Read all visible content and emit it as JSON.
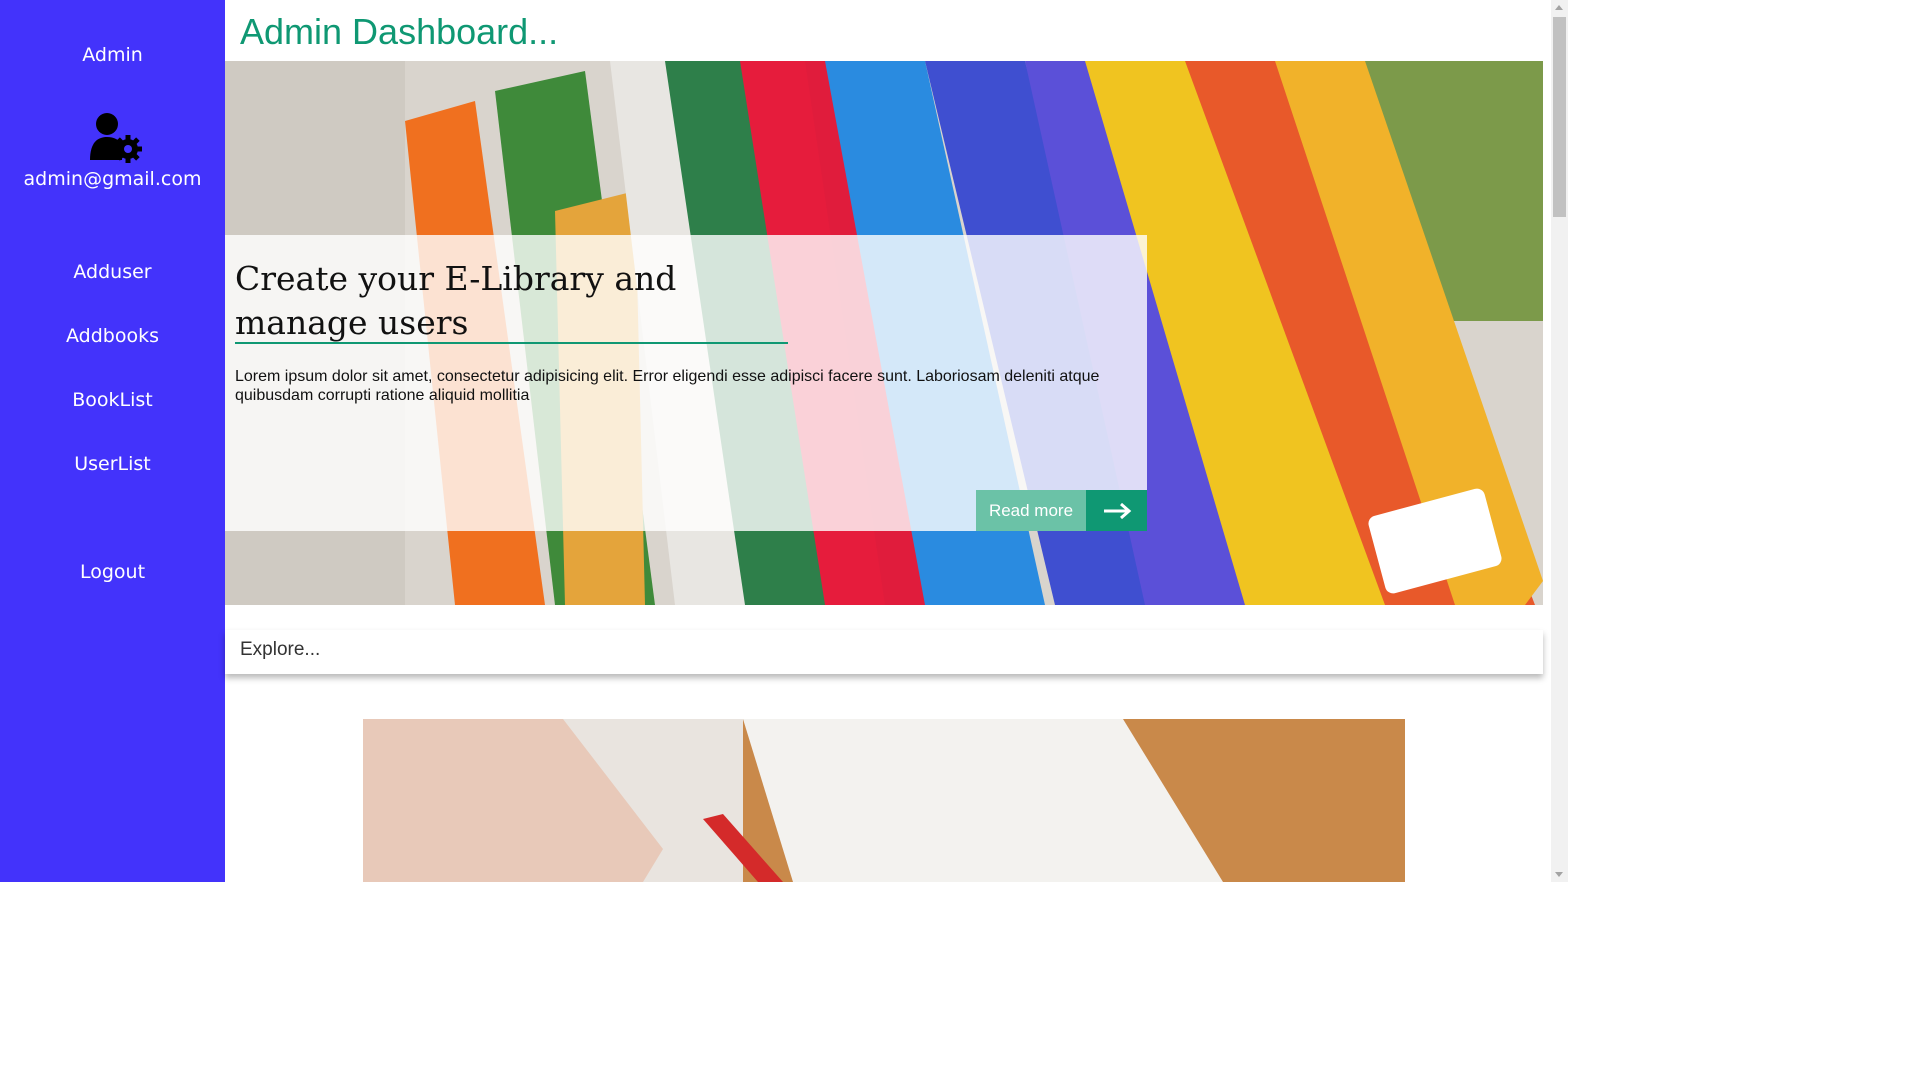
{
  "sidebar": {
    "title": "Admin",
    "avatar_icon": "user-gear-icon",
    "email": "admin@gmail.com",
    "items": [
      {
        "label": "Adduser"
      },
      {
        "label": "Addbooks"
      },
      {
        "label": "BookList"
      },
      {
        "label": "UserList"
      }
    ],
    "logout_label": "Logout",
    "background": "#4333fb"
  },
  "header": {
    "title": "Admin Dashboard...",
    "title_color": "#0f9873"
  },
  "hero": {
    "heading": "Create your E-Library and manage users",
    "text": "Lorem ipsum dolor sit amet, consectetur adipisicing elit. Error eligendi esse adipisci facere sunt. Laboriosam deleniti atque quibusdam corrupti ratione aliquid mollitia",
    "read_more_label": "Read more",
    "arrow_icon": "arrow-right-icon",
    "accent": "#0f9873",
    "image_subject": "books-photo"
  },
  "explore": {
    "label": "Explore..."
  },
  "lower_image": {
    "subject": "hand-writing-photo"
  }
}
